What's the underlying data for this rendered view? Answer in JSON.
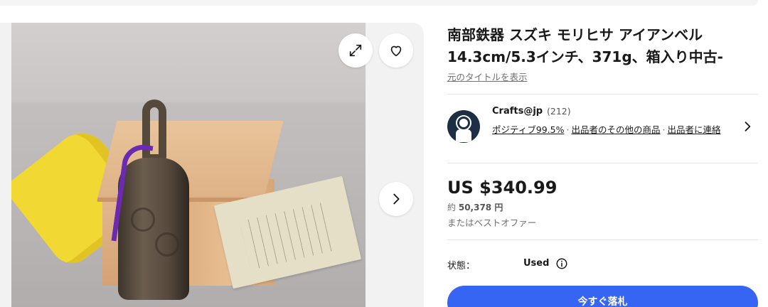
{
  "listing": {
    "title": "南部鉄器 スズキ モリヒサ アイアンベル 14.3cm/5.3インチ、371g、箱入り中古-",
    "original_title_link": "元のタイトルを表示"
  },
  "seller": {
    "name": "Crafts@jp",
    "feedback_count": "(212)",
    "positive": "ポジティブ99.5%",
    "other_items": "出品者のその他の商品",
    "contact": "出品者に連絡",
    "separator": "·"
  },
  "pricing": {
    "price": "US $340.99",
    "approx_prefix": "約",
    "approx_value": "50,378 円",
    "best_offer": "またはベストオファー"
  },
  "condition": {
    "label": "状態：",
    "value": "Used"
  },
  "actions": {
    "buy_now": "今すぐ落札"
  },
  "icons": {
    "expand": "expand-icon",
    "watch": "heart-icon",
    "next": "chevron-right-icon",
    "seller_chevron": "chevron-right-icon",
    "info": "info-icon"
  },
  "colors": {
    "primary_button": "#3665f3",
    "text": "#191919",
    "muted": "#707070"
  }
}
